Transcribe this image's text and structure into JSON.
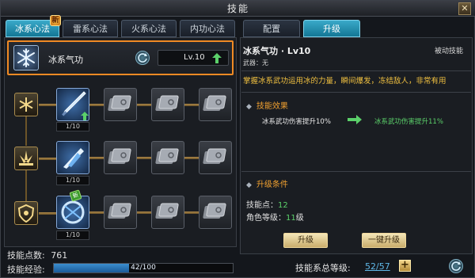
{
  "window": {
    "title": "技能",
    "close_label": "✕"
  },
  "left_tabs": [
    {
      "label": "冰系心法",
      "active": true
    },
    {
      "label": "雷系心法",
      "active": false
    },
    {
      "label": "火系心法",
      "active": false
    },
    {
      "label": "内功心法",
      "active": false
    }
  ],
  "new_badge_glyph": "新",
  "selected_skill": {
    "name": "冰系气功",
    "level": "Lv.10",
    "icon": "snowflake-icon"
  },
  "tree_rows": [
    {
      "type_icon": "snowflake-badge-icon",
      "first_count": "1/10",
      "first_icon": "ice-sword-icon"
    },
    {
      "type_icon": "spike-burst-icon",
      "first_count": "1/10",
      "first_icon": "ice-shard-icon"
    },
    {
      "type_icon": "shield-badge-icon",
      "first_count": "1/10",
      "first_icon": "ice-shield-icon"
    }
  ],
  "skill_points": {
    "label": "技能点数:",
    "value": "761"
  },
  "skill_exp": {
    "label": "技能经验:",
    "text": "42/100",
    "fraction": 0.42
  },
  "right_tabs": [
    {
      "label": "配置",
      "active": false
    },
    {
      "label": "升级",
      "active": true
    }
  ],
  "detail": {
    "title": "冰系气功 · Lv10",
    "passive": "被动技能",
    "weapon": "武器：无",
    "desc": "掌握冰系武功运用冰的力量，瞬间爆发，冻结敌人，非常有用",
    "effect_heading": "技能效果",
    "effect_current": "冰系武功伤害提升10%",
    "effect_next": "冰系武功伤害提升11%",
    "req_heading": "升级条件",
    "req_points_label": "技能点：",
    "req_points_value": "12",
    "req_level_label": "角色等级：",
    "req_level_value": "11",
    "req_level_suffix": "级",
    "upgrade_btn": "升级",
    "oneclick_btn": "一键升级"
  },
  "total": {
    "label": "技能系总等级:",
    "value": "52/57",
    "plus": "+"
  },
  "colors": {
    "accent": "#f08a24",
    "tab_active": "#2a9bbd",
    "green": "#5bd06a",
    "gold": "#f0c040"
  }
}
